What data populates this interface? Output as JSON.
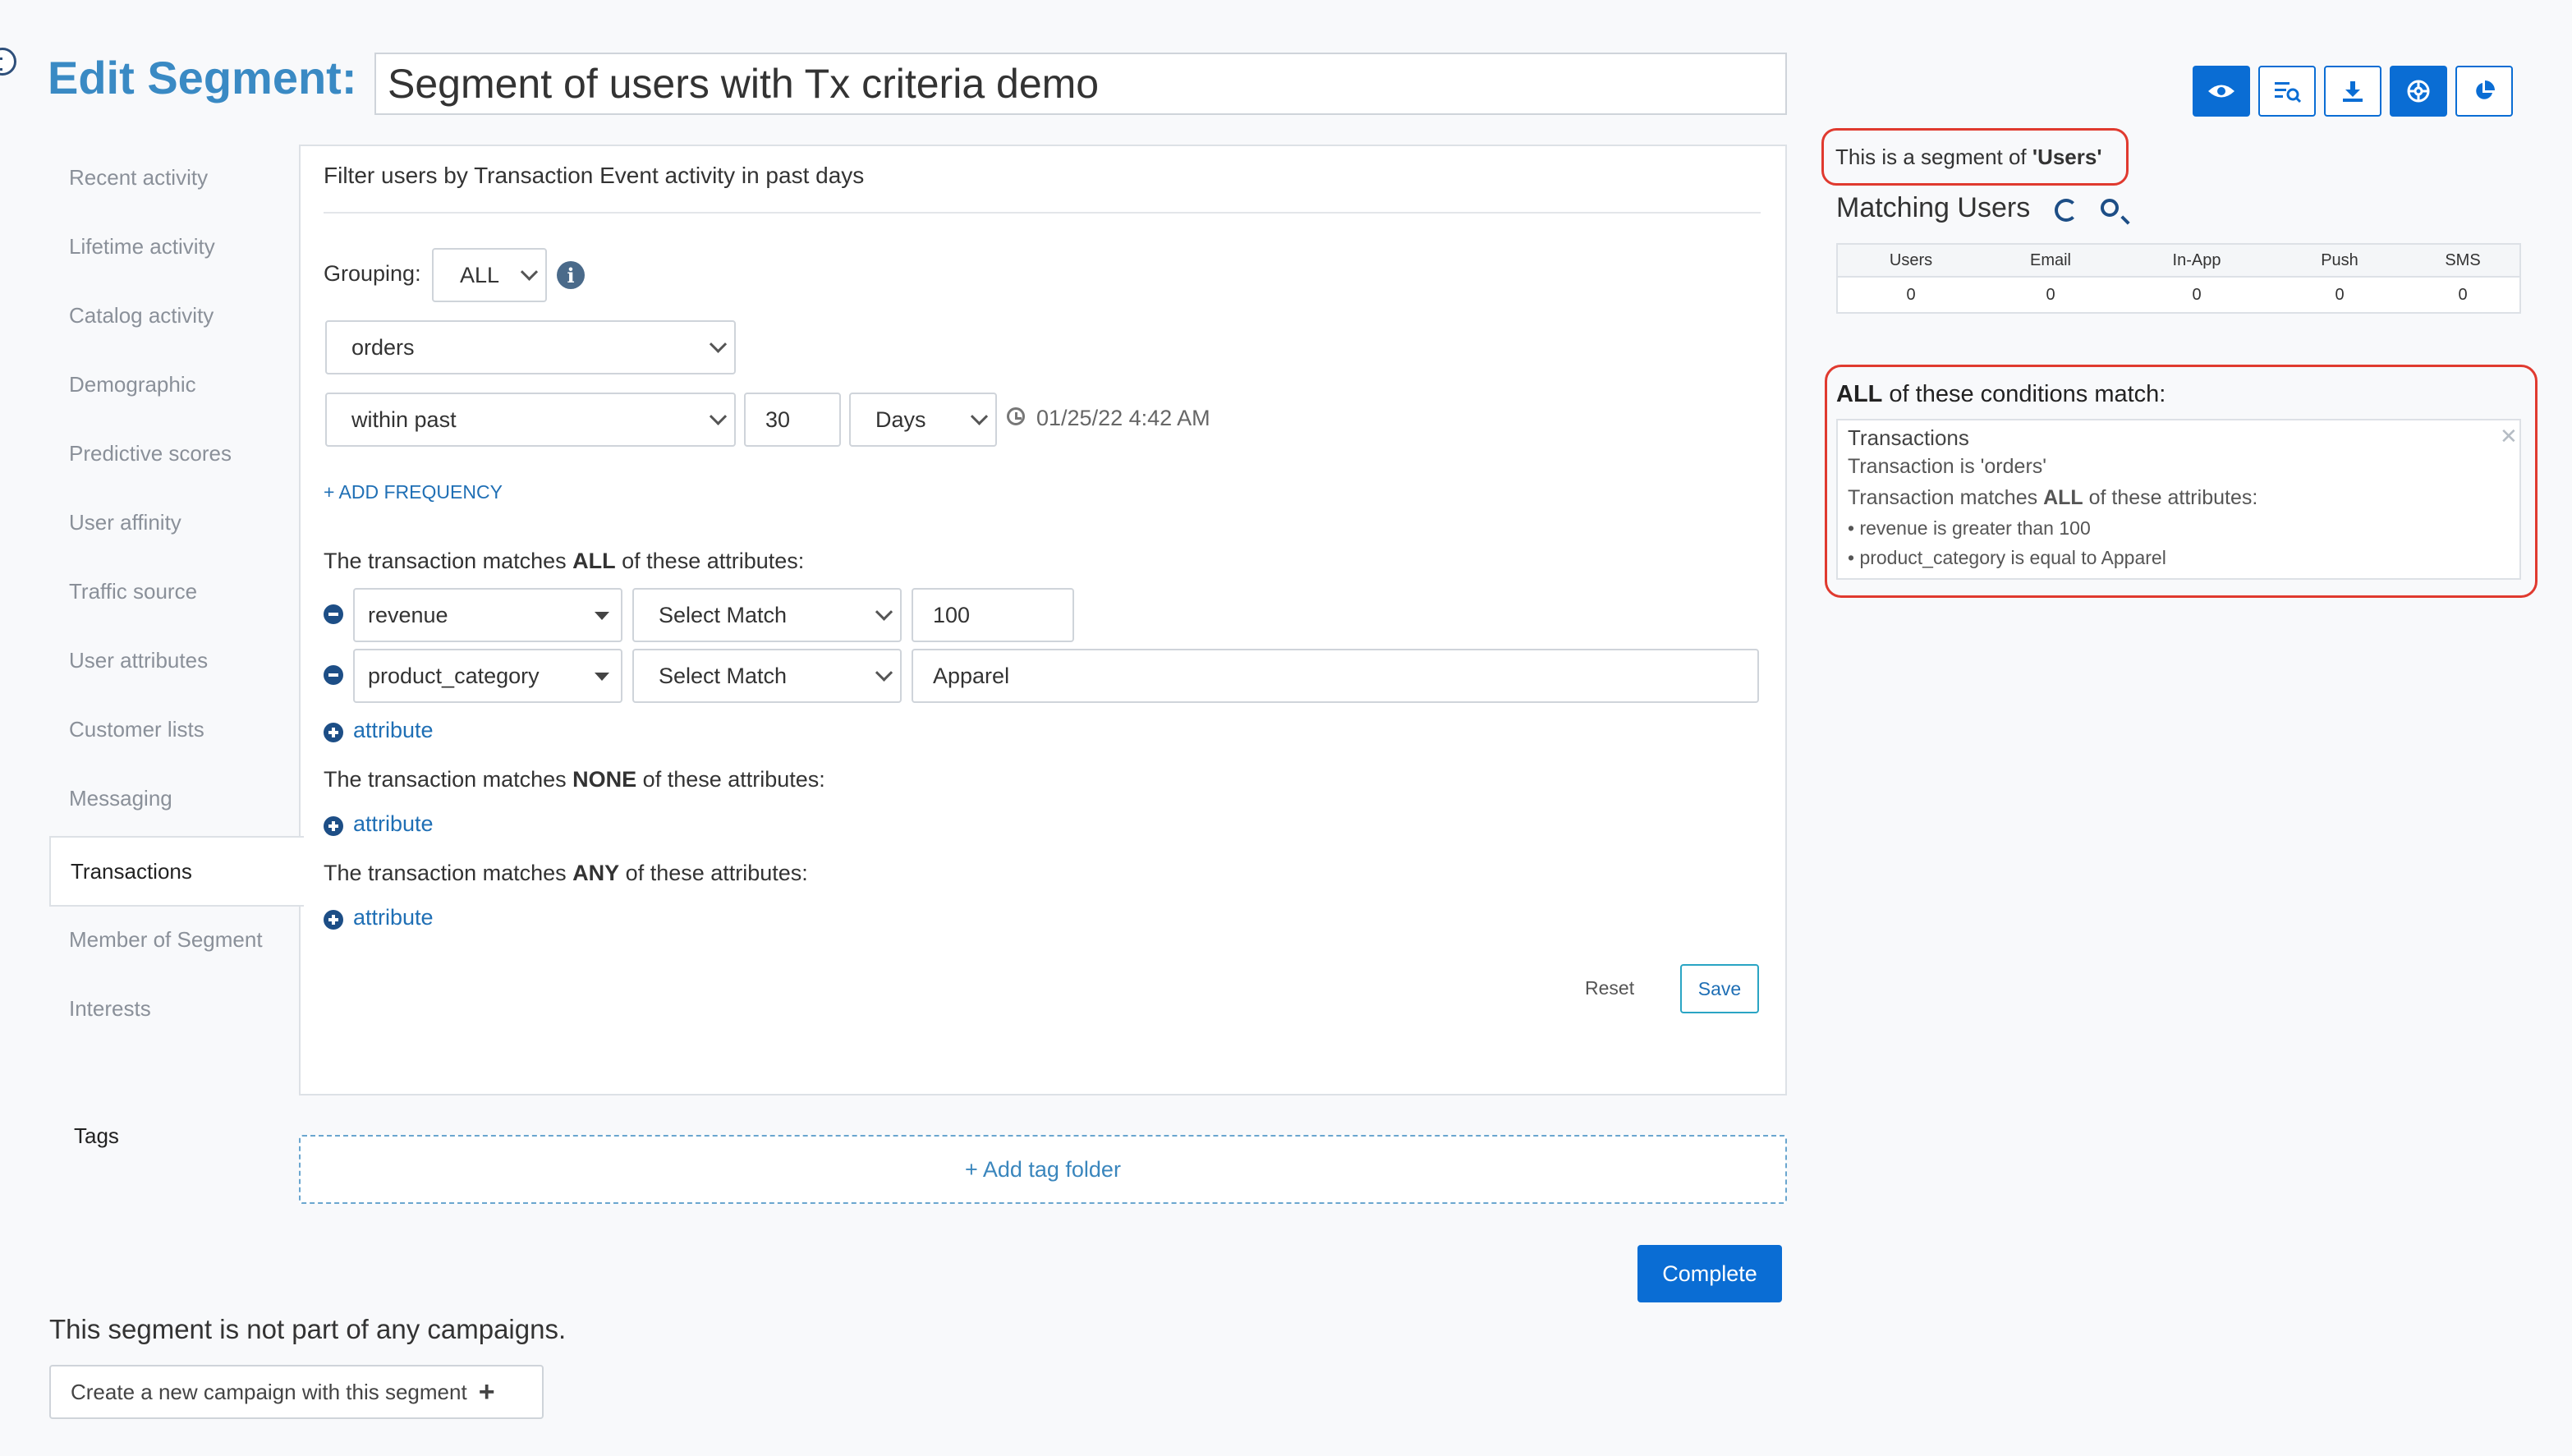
{
  "header": {
    "title": "Edit Segment:",
    "segment_name": "Segment of users with Tx criteria demo"
  },
  "toolbar": {
    "buttons": [
      "eye-icon",
      "preview-list-icon",
      "download-icon",
      "settings-wheel-icon",
      "pie-chart-icon"
    ],
    "accent": "#0a6dd4"
  },
  "sidebar": {
    "items": [
      "Recent activity",
      "Lifetime activity",
      "Catalog activity",
      "Demographic",
      "Predictive scores",
      "User affinity",
      "Traffic source",
      "User attributes",
      "Customer lists",
      "Messaging",
      "Transactions",
      "Member of Segment",
      "Interests"
    ],
    "active": "Transactions"
  },
  "filter": {
    "header": "Filter users by Transaction Event activity in past days",
    "grouping_label": "Grouping:",
    "grouping_value": "ALL",
    "event_value": "orders",
    "time_mode": "within past",
    "time_amount": "30",
    "time_unit": "Days",
    "timestamp": "01/25/22 4:42 AM",
    "add_frequency": "+ ADD FREQUENCY",
    "all_pre": "The transaction matches ",
    "all_kw": "ALL",
    "all_post": " of these attributes:",
    "rows": [
      {
        "attribute": "revenue",
        "match": "Select Match",
        "value": "100"
      },
      {
        "attribute": "product_category",
        "match": "Select Match",
        "value": "Apparel"
      }
    ],
    "attribute_link": "attribute",
    "none_pre": "The transaction matches ",
    "none_kw": "NONE",
    "none_post": " of these attributes:",
    "any_pre": "The transaction matches ",
    "any_kw": "ANY",
    "any_post": " of these attributes:",
    "reset": "Reset",
    "save": "Save"
  },
  "tags": {
    "label": "Tags",
    "add_folder": "+ Add tag folder"
  },
  "complete": "Complete",
  "campaigns": {
    "note": "This segment is not part of any campaigns.",
    "create_button": "Create a new campaign with this segment"
  },
  "summary": {
    "segment_of_pre": "This is a segment of ",
    "segment_of_value": "'Users'",
    "matching_title": "Matching Users",
    "stats_headers": [
      "Users",
      "Email",
      "In-App",
      "Push",
      "SMS"
    ],
    "stats_values": [
      "0",
      "0",
      "0",
      "0",
      "0"
    ],
    "cond_kw": "ALL",
    "cond_post": " of these conditions match:",
    "cond_card": {
      "title": "Transactions",
      "line1": "Transaction is 'orders'",
      "line2_pre": "Transaction matches ",
      "line2_kw": "ALL",
      "line2_post": " of these attributes:",
      "bullet1": "• revenue is greater than 100",
      "bullet2": "• product_category is equal to Apparel"
    },
    "highlight_color": "#e03a2f"
  }
}
